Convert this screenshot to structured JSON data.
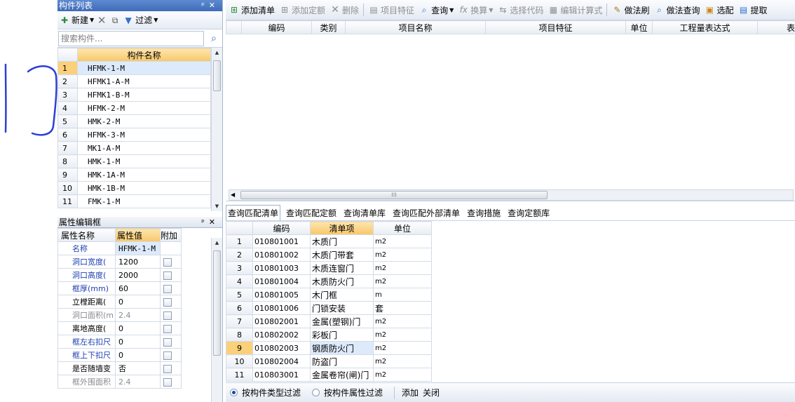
{
  "component_list": {
    "title": "构件列表",
    "toolbar": {
      "new_label": "新建",
      "filter_label": "过滤"
    },
    "search_placeholder": "搜索构件...",
    "column_header": "构件名称",
    "rows": [
      {
        "num": "1",
        "name": "HFMK-1-M"
      },
      {
        "num": "2",
        "name": "HFMK1-A-M"
      },
      {
        "num": "3",
        "name": "HFMK1-B-M"
      },
      {
        "num": "4",
        "name": "HFMK-2-M"
      },
      {
        "num": "5",
        "name": "HMK-2-M"
      },
      {
        "num": "6",
        "name": "HFMK-3-M"
      },
      {
        "num": "7",
        "name": "MK1-A-M"
      },
      {
        "num": "8",
        "name": "HMK-1-M"
      },
      {
        "num": "9",
        "name": "HMK-1A-M"
      },
      {
        "num": "10",
        "name": "HMK-1B-M"
      },
      {
        "num": "11",
        "name": "FMK-1-M"
      }
    ]
  },
  "property_editor": {
    "title": "属性编辑框",
    "headers": {
      "name": "属性名称",
      "value": "属性值",
      "extra": "附加"
    },
    "rows": [
      {
        "name": "名称",
        "value": "HFMK-1-M"
      },
      {
        "name": "洞口宽度(",
        "value": "1200"
      },
      {
        "name": "洞口高度(",
        "value": "2000"
      },
      {
        "name": "框厚(mm)",
        "value": "60"
      },
      {
        "name": "立樘距离(",
        "value": "0"
      },
      {
        "name": "洞口面积(m",
        "value": "2.4"
      },
      {
        "name": "离地高度(",
        "value": "0"
      },
      {
        "name": "框左右扣尺",
        "value": "0"
      },
      {
        "name": "框上下扣尺",
        "value": "0"
      },
      {
        "name": "是否随墙变",
        "value": "否"
      },
      {
        "name": "框外围面积",
        "value": "2.4"
      }
    ]
  },
  "main_toolbar": {
    "add_list": "添加清单",
    "add_quota": "添加定额",
    "delete": "删除",
    "item_feature": "项目特征",
    "query": "查询",
    "convert": "换算",
    "select_code": "选择代码",
    "edit_formula": "编辑计算式",
    "method_brush": "做法刷",
    "method_query": "做法查询",
    "select_match": "选配",
    "extract": "提取"
  },
  "upper_table": {
    "headers": [
      "编码",
      "类别",
      "项目名称",
      "项目特征",
      "单位",
      "工程量表达式",
      "表"
    ]
  },
  "tabs": [
    {
      "label": "查询匹配清单",
      "active": true
    },
    {
      "label": "查询匹配定额"
    },
    {
      "label": "查询清单库"
    },
    {
      "label": "查询匹配外部清单"
    },
    {
      "label": "查询措施"
    },
    {
      "label": "查询定额库"
    }
  ],
  "match_table": {
    "headers": [
      "编码",
      "清单项",
      "单位"
    ],
    "rows": [
      {
        "num": "1",
        "code": "010801001",
        "item": "木质门",
        "unit": "m2"
      },
      {
        "num": "2",
        "code": "010801002",
        "item": "木质门带套",
        "unit": "m2"
      },
      {
        "num": "3",
        "code": "010801003",
        "item": "木质连窗门",
        "unit": "m2"
      },
      {
        "num": "4",
        "code": "010801004",
        "item": "木质防火门",
        "unit": "m2"
      },
      {
        "num": "5",
        "code": "010801005",
        "item": "木门框",
        "unit": "m"
      },
      {
        "num": "6",
        "code": "010801006",
        "item": "门锁安装",
        "unit": "套"
      },
      {
        "num": "7",
        "code": "010802001",
        "item": "金属(塑钢)门",
        "unit": "m2"
      },
      {
        "num": "8",
        "code": "010802002",
        "item": "彩板门",
        "unit": "m2"
      },
      {
        "num": "9",
        "code": "010802003",
        "item": "钢质防火门",
        "unit": "m2"
      },
      {
        "num": "10",
        "code": "010802004",
        "item": "防盗门",
        "unit": "m2"
      },
      {
        "num": "11",
        "code": "010803001",
        "item": "金属卷帘(闸)门",
        "unit": "m2"
      }
    ]
  },
  "bottom_bar": {
    "filter_by_type": "按构件类型过滤",
    "filter_by_attr": "按构件属性过滤",
    "add": "添加",
    "close": "关闭"
  },
  "colors": {
    "title_bar": "#4a78c4",
    "header_highlight": "#f8c768",
    "selected_row": "#ddeafc",
    "annotation": "#2b3fd6"
  }
}
